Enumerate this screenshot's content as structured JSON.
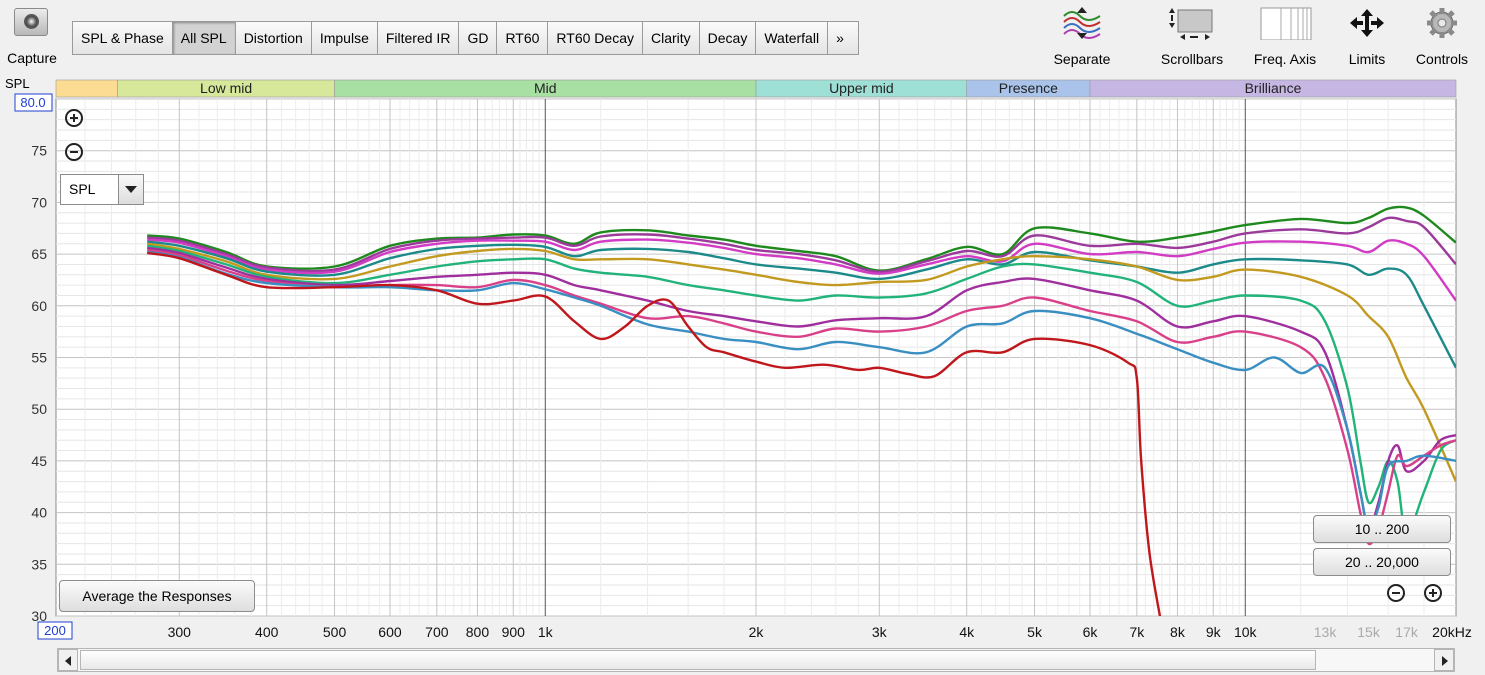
{
  "toolbar": {
    "capture_label": "Capture",
    "tabs": [
      "SPL & Phase",
      "All SPL",
      "Distortion",
      "Impulse",
      "Filtered IR",
      "GD",
      "RT60",
      "RT60 Decay",
      "Clarity",
      "Decay",
      "Waterfall",
      "»"
    ],
    "active_tab": "All SPL",
    "tools": [
      {
        "label": "Separate",
        "icon": "separate-icon"
      },
      {
        "label": "Scrollbars",
        "icon": "scrollbars-icon"
      },
      {
        "label": "Freq. Axis",
        "icon": "freq-axis-icon"
      },
      {
        "label": "Limits",
        "icon": "limits-icon"
      },
      {
        "label": "Controls",
        "icon": "gear-icon"
      }
    ]
  },
  "controls": {
    "spl_select_value": "SPL",
    "average_button": "Average the Responses",
    "range_button_1": "10 .. 200",
    "range_button_2": "20 .. 20,000"
  },
  "chart_data": {
    "type": "line",
    "ylabel": "SPL",
    "xunit": "kHz",
    "y_top_label": "80.0",
    "x_left_label": "200",
    "ylim": [
      30,
      80
    ],
    "xlim": [
      200,
      20000
    ],
    "xscale": "log",
    "grid": true,
    "yticks": [
      30,
      35,
      40,
      45,
      50,
      55,
      60,
      65,
      70,
      75
    ],
    "xticks": [
      {
        "f": 300,
        "label": "300",
        "dim": false
      },
      {
        "f": 400,
        "label": "400",
        "dim": false
      },
      {
        "f": 500,
        "label": "500",
        "dim": false
      },
      {
        "f": 600,
        "label": "600",
        "dim": false
      },
      {
        "f": 700,
        "label": "700",
        "dim": false
      },
      {
        "f": 800,
        "label": "800",
        "dim": false
      },
      {
        "f": 900,
        "label": "900",
        "dim": false
      },
      {
        "f": 1000,
        "label": "1k",
        "dim": false
      },
      {
        "f": 2000,
        "label": "2k",
        "dim": false
      },
      {
        "f": 3000,
        "label": "3k",
        "dim": false
      },
      {
        "f": 4000,
        "label": "4k",
        "dim": false
      },
      {
        "f": 5000,
        "label": "5k",
        "dim": false
      },
      {
        "f": 6000,
        "label": "6k",
        "dim": false
      },
      {
        "f": 7000,
        "label": "7k",
        "dim": false
      },
      {
        "f": 8000,
        "label": "8k",
        "dim": false
      },
      {
        "f": 9000,
        "label": "9k",
        "dim": false
      },
      {
        "f": 10000,
        "label": "10k",
        "dim": false
      },
      {
        "f": 13000,
        "label": "13k",
        "dim": true
      },
      {
        "f": 15000,
        "label": "15k",
        "dim": true
      },
      {
        "f": 17000,
        "label": "17k",
        "dim": true
      },
      {
        "f": 20000,
        "label": "20kHz",
        "dim": false
      }
    ],
    "bands": [
      {
        "label": "",
        "from": 200,
        "to": 245,
        "color": "#fbdc92"
      },
      {
        "label": "Low mid",
        "from": 245,
        "to": 500,
        "color": "#d7e89b"
      },
      {
        "label": "Mid",
        "from": 500,
        "to": 2000,
        "color": "#a8e0a4"
      },
      {
        "label": "Upper mid",
        "from": 2000,
        "to": 4000,
        "color": "#9fe0d6"
      },
      {
        "label": "Presence",
        "from": 4000,
        "to": 6000,
        "color": "#a9c3ea"
      },
      {
        "label": "Brilliance",
        "from": 6000,
        "to": 20000,
        "color": "#c6b6e4"
      }
    ],
    "series": [
      {
        "color": "#1e8a1e",
        "x": [
          270,
          300,
          350,
          400,
          500,
          600,
          700,
          800,
          900,
          1000,
          1100,
          1200,
          1400,
          1600,
          1800,
          2000,
          2300,
          2600,
          3000,
          3500,
          4000,
          4500,
          5000,
          6000,
          7000,
          8000,
          9000,
          10000,
          12000,
          14000,
          15000,
          16000,
          17000,
          18000,
          20000
        ],
        "y": [
          66.8,
          66.5,
          65.2,
          63.8,
          63.8,
          65.8,
          66.5,
          66.6,
          66.9,
          66.8,
          66.0,
          67.1,
          67.3,
          66.8,
          66.4,
          65.8,
          65.3,
          64.8,
          63.4,
          64.5,
          65.7,
          65.0,
          67.5,
          67.0,
          66.2,
          66.6,
          67.2,
          67.8,
          68.4,
          68.0,
          68.5,
          69.4,
          69.5,
          68.7,
          66.1
        ]
      },
      {
        "color": "#9b3a9b",
        "x": [
          270,
          300,
          350,
          400,
          500,
          600,
          700,
          800,
          900,
          1000,
          1100,
          1200,
          1400,
          1600,
          1800,
          2000,
          2300,
          2600,
          3000,
          3500,
          4000,
          4500,
          5000,
          6000,
          7000,
          8000,
          9000,
          10000,
          12000,
          14000,
          15000,
          16000,
          17000,
          18000,
          20000
        ],
        "y": [
          66.6,
          66.3,
          65.0,
          63.7,
          63.5,
          65.5,
          66.3,
          66.5,
          66.6,
          66.6,
          65.8,
          66.7,
          66.9,
          66.5,
          66.0,
          65.4,
          65.0,
          64.4,
          63.3,
          64.3,
          65.3,
          64.8,
          66.8,
          65.8,
          66.0,
          65.6,
          66.2,
          67.0,
          67.4,
          67.0,
          67.6,
          68.5,
          68.2,
          67.6,
          64.0
        ]
      },
      {
        "color": "#d23cc4",
        "x": [
          270,
          300,
          350,
          400,
          500,
          600,
          700,
          800,
          900,
          1000,
          1100,
          1200,
          1400,
          1600,
          1800,
          2000,
          2300,
          2600,
          3000,
          3500,
          4000,
          4500,
          5000,
          6000,
          7000,
          8000,
          9000,
          10000,
          12000,
          14000,
          15000,
          16000,
          17000,
          18000,
          20000
        ],
        "y": [
          66.4,
          66.1,
          64.8,
          63.5,
          63.3,
          65.2,
          66.0,
          66.3,
          66.3,
          66.2,
          65.4,
          66.2,
          66.4,
          66.1,
          65.6,
          65.0,
          64.6,
          64.0,
          63.1,
          64.0,
          64.8,
          64.3,
          66.0,
          65.0,
          65.2,
          64.8,
          65.5,
          66.1,
          66.2,
          65.8,
          65.2,
          66.3,
          66.0,
          64.8,
          60.5
        ]
      },
      {
        "color": "#1d8a8a",
        "x": [
          270,
          300,
          350,
          400,
          500,
          600,
          700,
          800,
          900,
          1000,
          1100,
          1200,
          1400,
          1600,
          1800,
          2000,
          2300,
          2600,
          3000,
          3500,
          4000,
          4500,
          5000,
          6000,
          7000,
          8000,
          9000,
          10000,
          12000,
          14000,
          15000,
          16000,
          17000,
          18000,
          20000
        ],
        "y": [
          66.2,
          65.8,
          64.6,
          63.3,
          63.0,
          64.6,
          65.5,
          65.8,
          65.9,
          65.7,
          64.8,
          65.4,
          65.5,
          65.2,
          64.6,
          64.0,
          63.6,
          63.2,
          62.6,
          63.5,
          64.5,
          64.0,
          65.2,
          64.4,
          63.8,
          63.2,
          64.0,
          64.5,
          64.4,
          64.0,
          63.0,
          63.6,
          63.0,
          60.0,
          54.0
        ]
      },
      {
        "color": "#c29a20",
        "x": [
          270,
          300,
          350,
          400,
          500,
          600,
          700,
          800,
          900,
          1000,
          1100,
          1200,
          1400,
          1600,
          1800,
          2000,
          2300,
          2600,
          3000,
          3500,
          4000,
          4500,
          5000,
          6000,
          7000,
          8000,
          9000,
          10000,
          12000,
          14000,
          15000,
          16000,
          17000,
          18000,
          20000
        ],
        "y": [
          66.0,
          65.5,
          64.3,
          63.0,
          62.6,
          63.8,
          64.8,
          65.3,
          65.5,
          65.3,
          64.5,
          64.5,
          64.5,
          64.0,
          63.5,
          63.0,
          62.3,
          62.0,
          62.3,
          62.5,
          63.8,
          64.5,
          64.8,
          64.5,
          63.8,
          62.5,
          62.8,
          63.5,
          62.8,
          61.0,
          59.0,
          57.0,
          53.0,
          50.0,
          43.0
        ]
      },
      {
        "color": "#22b37a",
        "x": [
          270,
          300,
          350,
          400,
          500,
          600,
          700,
          800,
          900,
          1000,
          1100,
          1200,
          1400,
          1600,
          1800,
          2000,
          2300,
          2600,
          3000,
          3500,
          4000,
          4500,
          5000,
          6000,
          7000,
          8000,
          9000,
          10000,
          12000,
          13000,
          14000,
          14600,
          15000,
          15500,
          16000,
          16500,
          17000,
          18000,
          19000,
          20000
        ],
        "y": [
          65.8,
          65.3,
          64.0,
          62.8,
          62.2,
          63.0,
          63.8,
          64.3,
          64.5,
          64.5,
          63.6,
          63.2,
          62.8,
          62.0,
          61.5,
          61.0,
          60.5,
          61.0,
          60.8,
          61.2,
          62.6,
          63.8,
          64.0,
          63.2,
          62.3,
          60.0,
          60.5,
          61.0,
          60.5,
          58.5,
          52.0,
          45.0,
          41.0,
          42.5,
          45.0,
          43.0,
          38.0,
          42.0,
          46.0,
          47.0
        ]
      },
      {
        "color": "#a02f9e",
        "x": [
          270,
          300,
          350,
          400,
          500,
          600,
          700,
          800,
          900,
          1000,
          1100,
          1200,
          1400,
          1600,
          1800,
          2000,
          2300,
          2600,
          3000,
          3500,
          4000,
          4500,
          5000,
          6000,
          7000,
          8000,
          9000,
          10000,
          12000,
          13000,
          14000,
          14600,
          15000,
          15500,
          16000,
          16500,
          17000,
          18000,
          19000,
          20000
        ],
        "y": [
          65.6,
          65.1,
          63.7,
          62.6,
          62.0,
          62.4,
          62.8,
          63.0,
          63.2,
          63.0,
          62.0,
          61.5,
          60.5,
          59.5,
          59.0,
          58.5,
          58.0,
          58.6,
          58.8,
          59.0,
          61.5,
          62.3,
          62.6,
          61.5,
          60.5,
          58.0,
          58.5,
          59.0,
          57.5,
          55.5,
          48.0,
          42.0,
          38.5,
          41.0,
          45.0,
          46.5,
          44.0,
          45.0,
          47.0,
          47.5
        ]
      },
      {
        "color": "#d9408a",
        "x": [
          270,
          300,
          350,
          400,
          500,
          600,
          700,
          800,
          900,
          1000,
          1100,
          1200,
          1400,
          1600,
          1800,
          2000,
          2300,
          2600,
          3000,
          3500,
          4000,
          4500,
          5000,
          6000,
          7000,
          8000,
          9000,
          10000,
          12000,
          13000,
          14000,
          14600,
          15000,
          15500,
          16000,
          16500,
          17000,
          18000,
          19000,
          20000
        ],
        "y": [
          65.4,
          64.9,
          63.4,
          62.4,
          61.8,
          62.0,
          62.0,
          61.8,
          62.5,
          62.0,
          61.0,
          60.2,
          58.8,
          59.0,
          58.3,
          57.5,
          57.0,
          57.8,
          57.5,
          58.0,
          59.5,
          60.0,
          60.8,
          59.5,
          58.5,
          56.5,
          57.0,
          57.5,
          56.0,
          53.0,
          46.0,
          40.0,
          37.0,
          38.5,
          42.0,
          45.5,
          44.5,
          45.5,
          46.5,
          47.0
        ]
      },
      {
        "color": "#3a8fc2",
        "x": [
          270,
          300,
          350,
          400,
          500,
          600,
          700,
          800,
          900,
          1000,
          1100,
          1200,
          1400,
          1600,
          1800,
          2000,
          2300,
          2600,
          3000,
          3500,
          4000,
          4500,
          5000,
          6000,
          7000,
          8000,
          9000,
          10000,
          11000,
          12000,
          13000,
          14000,
          14600,
          15000,
          15500,
          16000,
          17000,
          18000,
          20000
        ],
        "y": [
          65.2,
          64.7,
          63.1,
          62.2,
          61.8,
          61.8,
          61.5,
          61.5,
          62.2,
          61.6,
          60.8,
          60.0,
          58.2,
          57.5,
          56.8,
          56.5,
          55.8,
          56.5,
          56.0,
          55.5,
          58.0,
          58.3,
          59.5,
          58.8,
          57.3,
          55.8,
          54.5,
          53.8,
          55.0,
          53.5,
          54.0,
          48.0,
          42.0,
          38.5,
          40.5,
          44.5,
          45.0,
          45.5,
          45.0
        ]
      },
      {
        "color": "#c0171c",
        "x": [
          270,
          300,
          350,
          400,
          500,
          600,
          700,
          800,
          900,
          1000,
          1100,
          1200,
          1300,
          1400,
          1500,
          1600,
          1700,
          1800,
          2000,
          2200,
          2500,
          2800,
          3000,
          3300,
          3600,
          4000,
          4500,
          5000,
          6000,
          6800,
          7000,
          7100,
          7300,
          7600
        ],
        "y": [
          65.1,
          64.6,
          63.0,
          61.8,
          61.8,
          62.0,
          61.5,
          60.2,
          60.5,
          60.9,
          58.5,
          56.8,
          58.0,
          60.0,
          60.5,
          58.0,
          56.0,
          55.5,
          54.6,
          54.0,
          54.3,
          53.8,
          54.0,
          53.4,
          53.2,
          55.5,
          55.5,
          56.8,
          56.2,
          54.5,
          53.0,
          45.0,
          36.0,
          29.0
        ]
      }
    ]
  }
}
